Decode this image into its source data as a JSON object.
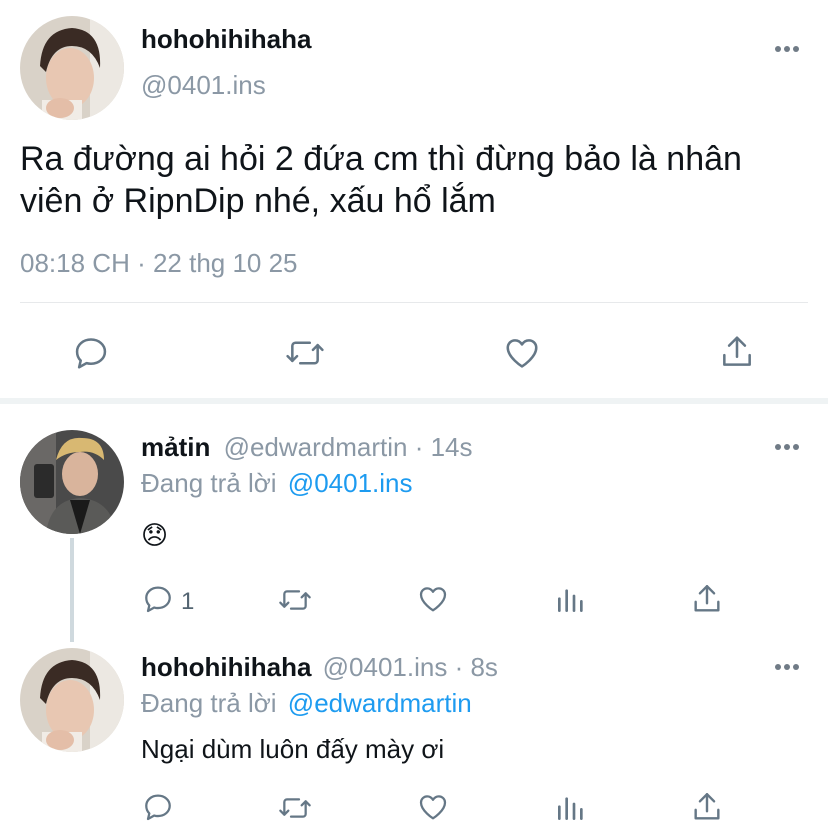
{
  "main_tweet": {
    "display_name": "hohohihihaha",
    "handle": "@0401.ins",
    "text_line1": "Ra đường ai hỏi 2 đứa cm thì đừng bảo là nhân",
    "text_line2": "viên ở RipnDip nhé, xấu hổ lắm",
    "timestamp": "08:18 CH · 22 thg 10 25"
  },
  "reply1": {
    "display_name": "mảtin",
    "handle_time": "@edwardmartin · 14s",
    "replying_label": "Đang trả lời",
    "replying_to": "@0401.ins",
    "text": "😞",
    "reply_count": "1"
  },
  "reply2": {
    "display_name": "hohohihihaha",
    "handle_time": "@0401.ins · 8s",
    "replying_label": "Đang trả lời",
    "replying_to": "@edwardmartin",
    "text": "Ngại dùm luôn đấy mày ơi"
  },
  "icons": [
    "more-icon",
    "reply-icon",
    "retweet-icon",
    "like-icon",
    "share-icon",
    "analytics-icon"
  ],
  "colors": {
    "accent": "#1d9bf0",
    "muted": "#8b98a5",
    "icon": "#657786"
  }
}
